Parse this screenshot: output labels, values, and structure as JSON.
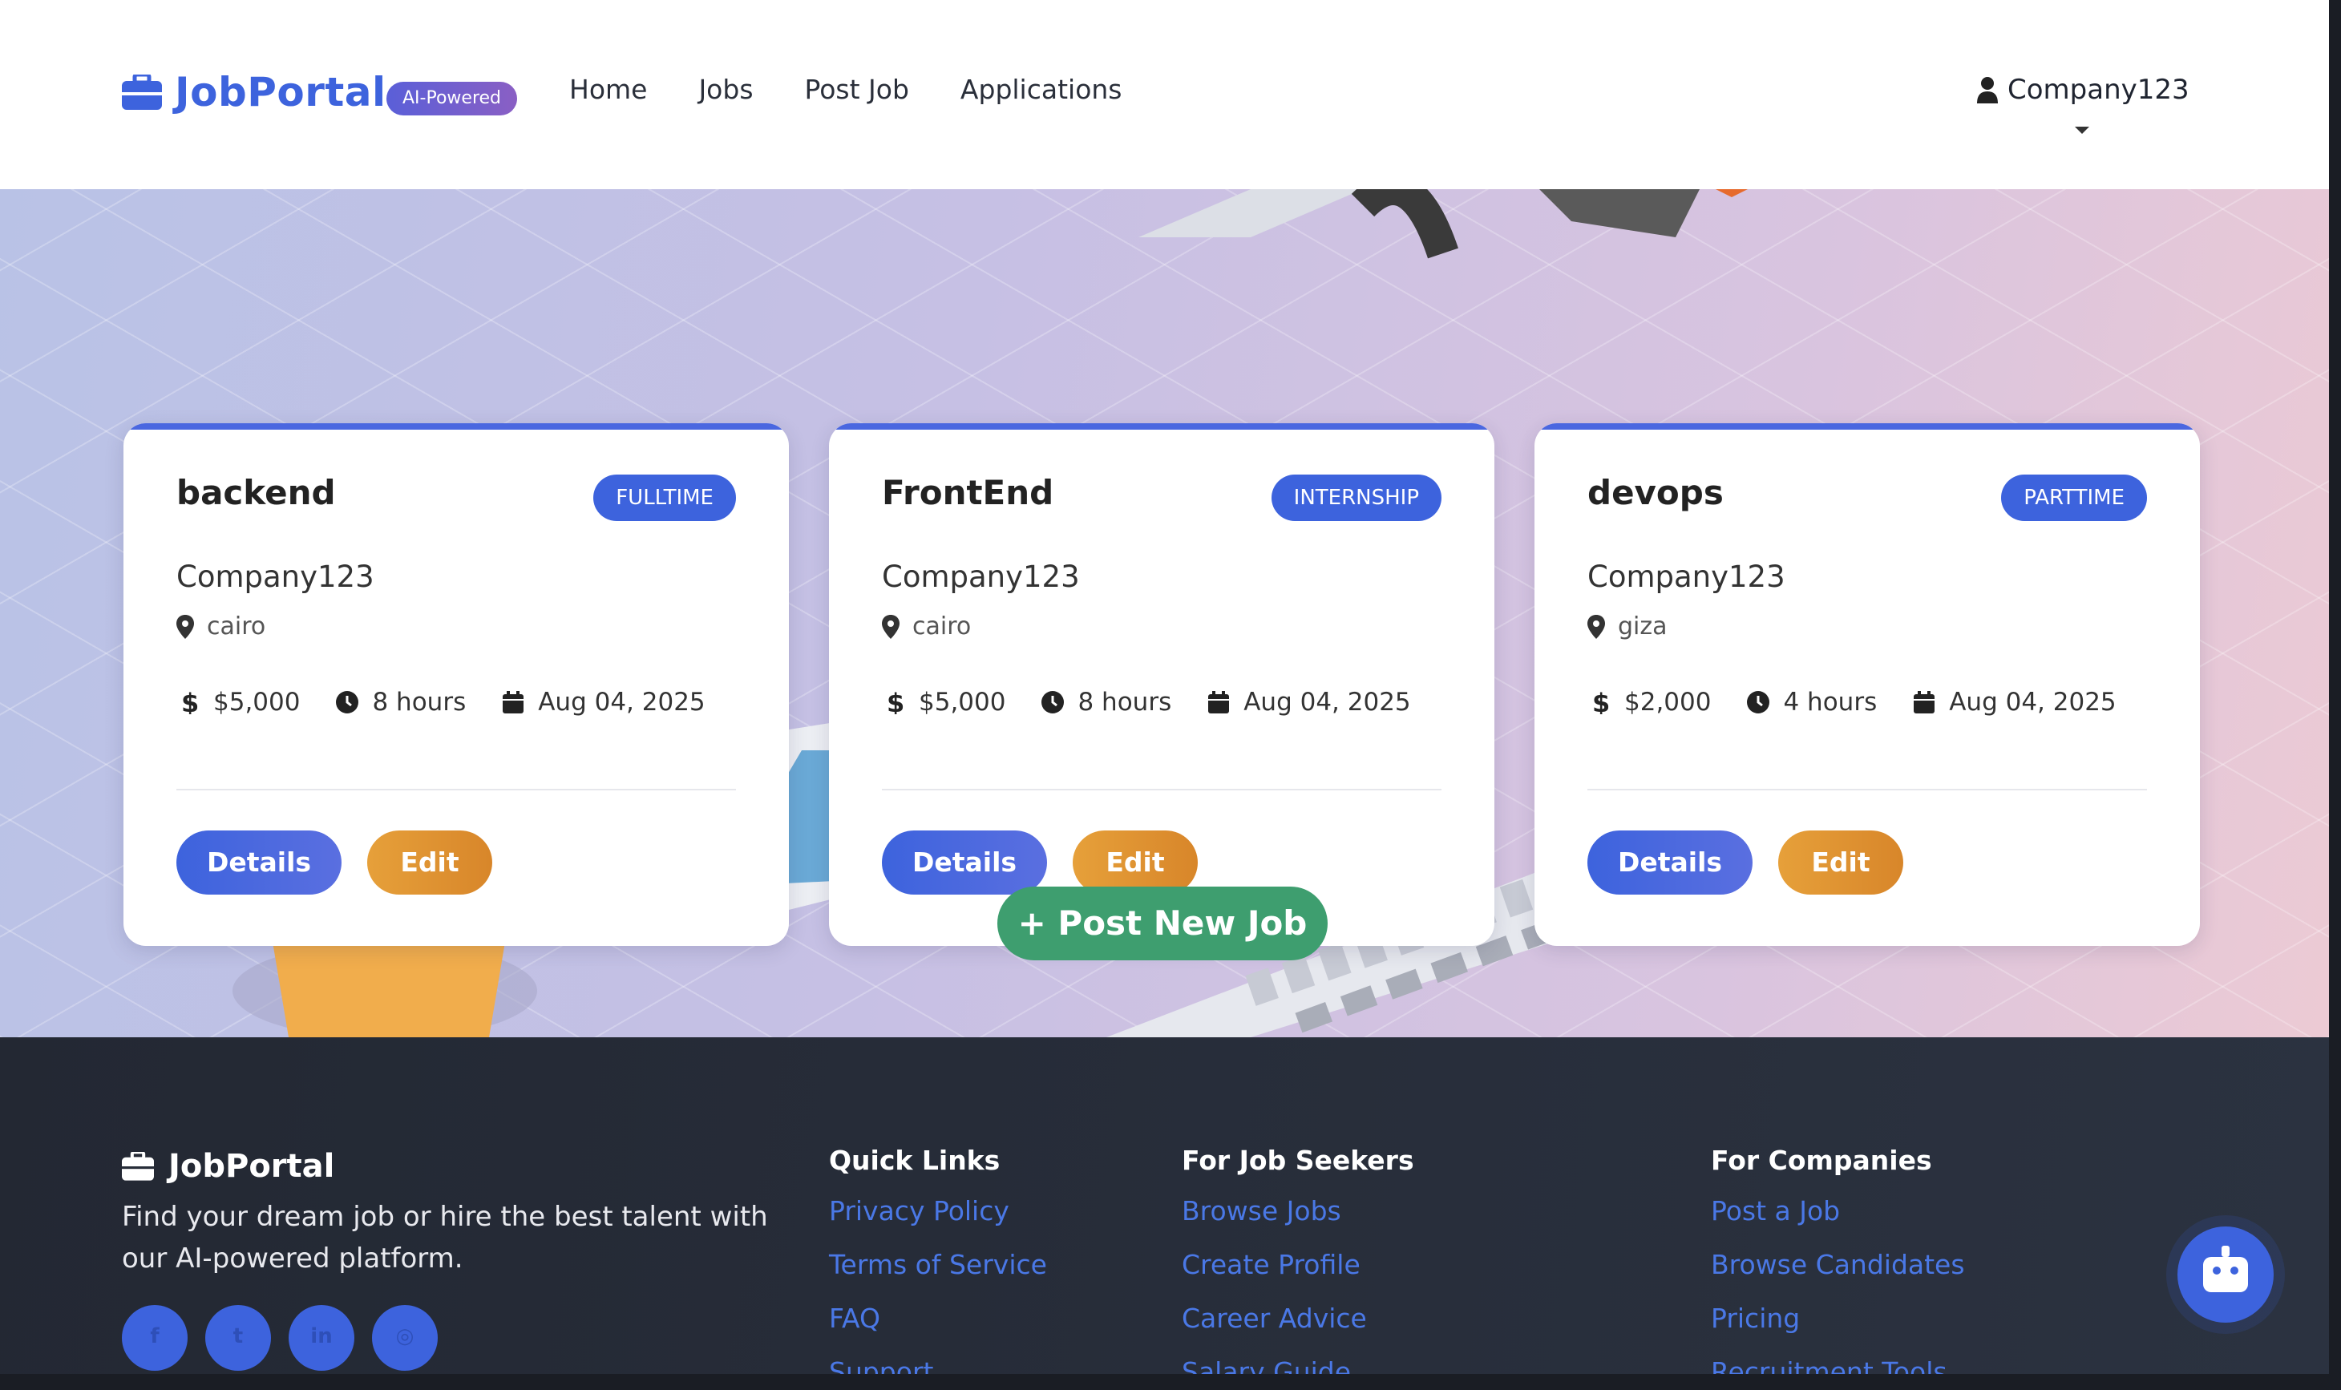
{
  "colors": {
    "accent": "#3d63dd",
    "edit": "#e09535",
    "success": "#3e9e6f",
    "footer_bg": "#262c38"
  },
  "navbar": {
    "brand": "JobPortal",
    "badge": "AI-Powered",
    "links": [
      "Home",
      "Jobs",
      "Post Job",
      "Applications"
    ],
    "user": "Company123"
  },
  "jobs": [
    {
      "title": "backend",
      "type": "FULLTIME",
      "company": "Company123",
      "location": "cairo",
      "salary": "$5,000",
      "hours": "8 hours",
      "date": "Aug 04, 2025"
    },
    {
      "title": "FrontEnd",
      "type": "INTERNSHIP",
      "company": "Company123",
      "location": "cairo",
      "salary": "$5,000",
      "hours": "8 hours",
      "date": "Aug 04, 2025"
    },
    {
      "title": "devops",
      "type": "PARTTIME",
      "company": "Company123",
      "location": "giza",
      "salary": "$2,000",
      "hours": "4 hours",
      "date": "Aug 04, 2025"
    }
  ],
  "buttons": {
    "details": "Details",
    "edit": "Edit",
    "post_new": "+ Post New Job"
  },
  "footer": {
    "brand": "JobPortal",
    "description": "Find your dream job or hire the best talent with our AI-powered platform.",
    "socials": [
      "facebook-icon",
      "twitter-icon",
      "linkedin-icon",
      "instagram-icon"
    ],
    "columns": [
      {
        "title": "Quick Links",
        "links": [
          "Privacy Policy",
          "Terms of Service",
          "FAQ",
          "Support"
        ]
      },
      {
        "title": "For Job Seekers",
        "links": [
          "Browse Jobs",
          "Create Profile",
          "Career Advice",
          "Salary Guide"
        ]
      },
      {
        "title": "For Companies",
        "links": [
          "Post a Job",
          "Browse Candidates",
          "Pricing",
          "Recruitment Tools"
        ]
      }
    ]
  }
}
